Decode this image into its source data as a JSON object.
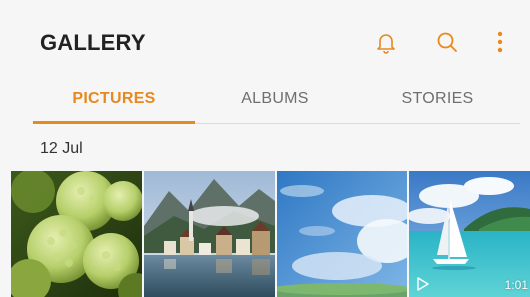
{
  "header": {
    "title": "GALLERY",
    "icons": [
      "bell-icon",
      "search-icon",
      "more-vertical-icon"
    ]
  },
  "tabs": [
    {
      "label": "PICTURES",
      "active": true
    },
    {
      "label": "ALBUMS",
      "active": false
    },
    {
      "label": "STORIES",
      "active": false
    }
  ],
  "section": {
    "date": "12 Jul"
  },
  "thumbnails": [
    {
      "subject": "green-hydrangea-flowers"
    },
    {
      "subject": "lakeside-alpine-village"
    },
    {
      "subject": "blue-sky-clouds"
    },
    {
      "subject": "sailboat-on-turquoise-sea",
      "is_video": true,
      "duration": "1:01"
    }
  ],
  "colors": {
    "accent": "#e6891f",
    "inactive_tab": "#6f6f6f",
    "background": "#f6f6f6",
    "title": "#222222"
  }
}
